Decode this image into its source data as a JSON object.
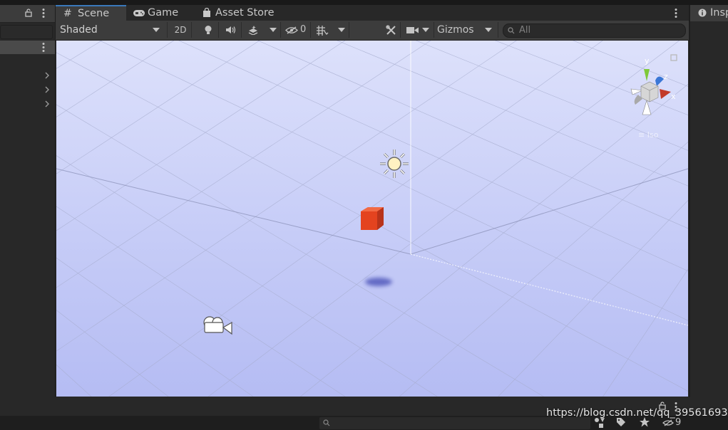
{
  "tabs": [
    {
      "label": "Scene",
      "icon": "hash-grid-icon",
      "active": true
    },
    {
      "label": "Game",
      "icon": "gamepad-icon",
      "active": false
    },
    {
      "label": "Asset Store",
      "icon": "shopping-bag-icon",
      "active": false
    }
  ],
  "inspector": {
    "tab_label": "Insp",
    "icon": "info-icon"
  },
  "toolbar": {
    "shading_mode": "Shaded",
    "toggle_2d": "2D",
    "hidden_count": "0",
    "gizmos_label": "Gizmos",
    "search_placeholder": "All"
  },
  "gizmo": {
    "x_label": "x",
    "y_label": "y",
    "z_label": "z",
    "projection_label": "≡ Iso"
  },
  "bottom": {
    "layers_count": "9"
  },
  "watermark": "https://blog.csdn.net/qq_39561693",
  "colors": {
    "accent": "#3a79bb",
    "cube": "#e4431f",
    "sky_top": "#dde1fb",
    "sky_bottom": "#b5bcf3"
  }
}
